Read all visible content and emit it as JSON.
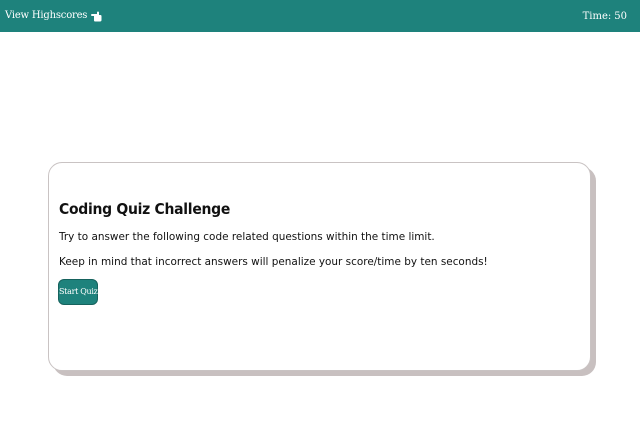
{
  "header": {
    "highscores_label": "View Highscores",
    "highscores_icon": "pointing-hand-icon",
    "timer_label": "Time:",
    "timer_value": "50"
  },
  "intro": {
    "title": "Coding Quiz Challenge",
    "line1": "Try to answer the following code related questions within the time limit.",
    "line2": "Keep in mind that incorrect answers will penalize your score/time by ten seconds!",
    "start_label": "Start Quiz"
  },
  "colors": {
    "accent": "#1e827c",
    "card_shadow": "#c8c0c0",
    "text": "#111111"
  }
}
